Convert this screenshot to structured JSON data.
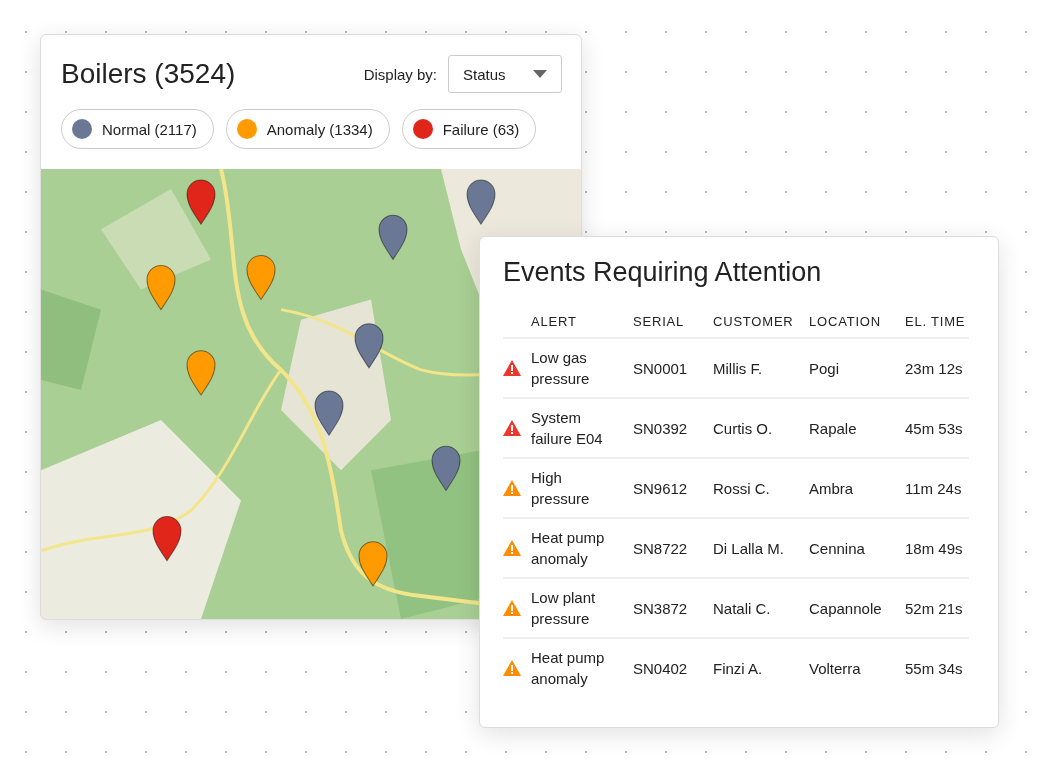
{
  "boilers_panel": {
    "title": "Boilers (3524)",
    "display_by": {
      "label": "Display by:",
      "value": "Status"
    },
    "legend": [
      {
        "label": "Normal (2117)",
        "color": "#6a7896"
      },
      {
        "label": "Anomaly (1334)",
        "color": "#ff9a00"
      },
      {
        "label": "Failure (63)",
        "color": "#e0251b"
      }
    ]
  },
  "events_panel": {
    "title": "Events Requiring Attention",
    "columns": [
      "ALERT",
      "SERIAL",
      "CUSTOMER",
      "LOCATION",
      "EL. TIME"
    ],
    "rows": [
      {
        "kind": "failure",
        "alert": "Low gas pressure",
        "serial": "SN0001",
        "customer": "Millis F.",
        "location": "Pogi",
        "time": "23m 12s"
      },
      {
        "kind": "failure",
        "alert": "System failure E04",
        "serial": "SN0392",
        "customer": "Curtis O.",
        "location": "Rapale",
        "time": "45m 53s"
      },
      {
        "kind": "anomaly",
        "alert": "High pressure",
        "serial": "SN9612",
        "customer": "Rossi C.",
        "location": "Ambra",
        "time": "11m 24s"
      },
      {
        "kind": "anomaly",
        "alert": "Heat pump anomaly",
        "serial": "SN8722",
        "customer": "Di Lalla M.",
        "location": "Cennina",
        "time": "18m 49s"
      },
      {
        "kind": "anomaly",
        "alert": "Low plant pressure",
        "serial": "SN3872",
        "customer": "Natali C.",
        "location": "Capannole",
        "time": "52m 21s"
      },
      {
        "kind": "anomaly",
        "alert": "Heat pump anomaly",
        "serial": "SN0402",
        "customer": "Finzi A.",
        "location": "Volterra",
        "time": "55m 34s"
      }
    ]
  }
}
